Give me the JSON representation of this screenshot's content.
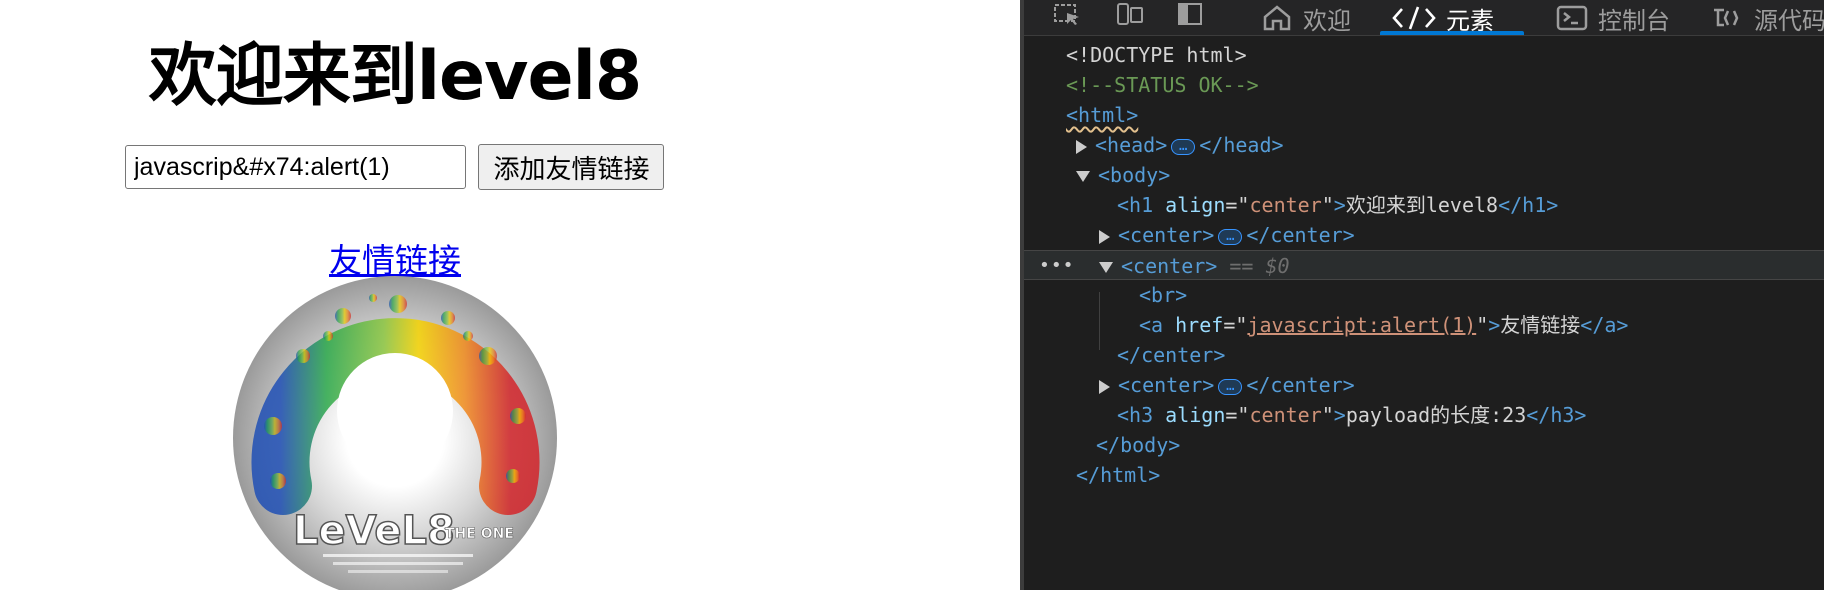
{
  "page": {
    "heading": "欢迎来到level8",
    "input_value": "javascrip&#x74:alert(1)",
    "add_button": "添加友情链接",
    "link_text": "友情链接",
    "disc_text": {
      "main": "LeVeL8",
      "sub": "THE ONE"
    }
  },
  "devtools": {
    "tabs": [
      {
        "label": "欢迎",
        "icon": "home-icon"
      },
      {
        "label": "元素",
        "icon": "elements-code-icon",
        "active": true
      },
      {
        "label": "控制台",
        "icon": "console-icon"
      },
      {
        "label": "源代码",
        "icon": "sources-icon"
      }
    ],
    "tree": {
      "doctype": "<!DOCTYPE html>",
      "comment": "<!--STATUS OK-->",
      "html_open": "<html>",
      "head_open": "<head>",
      "head_close": "</head>",
      "body_open": "<body>",
      "h1_tag": "<h1",
      "h1_attr_name": "align",
      "h1_attr_val": "center",
      "h1_text": "欢迎来到level8",
      "h1_close": "</h1>",
      "center_open": "<center>",
      "center_close": "</center>",
      "selected_marker": "== $0",
      "br": "<br>",
      "a_tag": "<a",
      "a_attr_name": "href",
      "a_attr_val": "javascript:alert(1)",
      "a_text": "友情链接",
      "a_close": "</a>",
      "h3_tag": "<h3",
      "h3_attr_name": "align",
      "h3_attr_val": "center",
      "h3_text": "payload的长度:23",
      "h3_close": "</h3>",
      "body_close": "</body>",
      "html_close": "</html>"
    }
  },
  "colors": {
    "devtools_bg": "#1e1e1e",
    "tag": "#569cd6",
    "attr": "#9cdcfe",
    "value": "#ce9178",
    "comment": "#6a9955",
    "accent": "#0078d4",
    "link": "#0000ee"
  }
}
